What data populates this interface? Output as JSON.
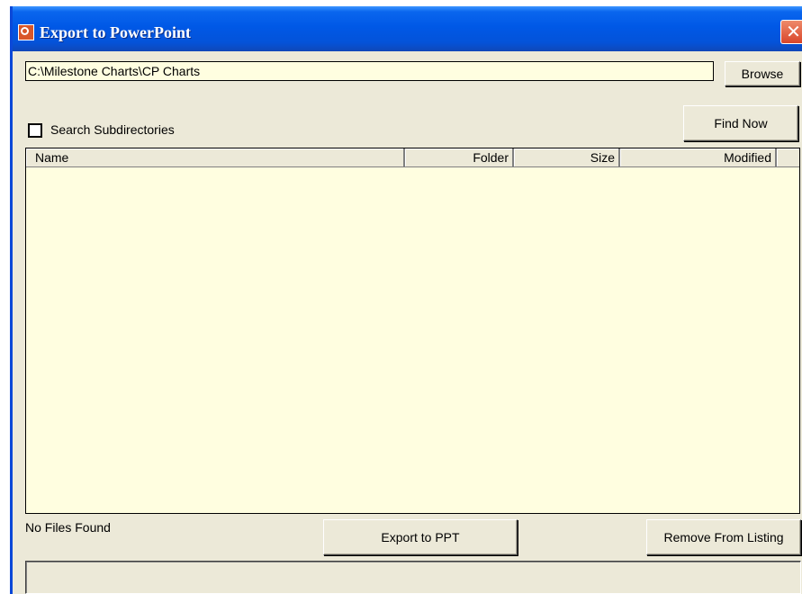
{
  "window": {
    "title": "Export to PowerPoint",
    "close_glyph": "✕"
  },
  "path": {
    "value": "C:\\Milestone Charts\\CP Charts"
  },
  "buttons": {
    "browse": "Browse",
    "find_now": "Find Now",
    "export": "Export to PPT",
    "remove": "Remove From Listing"
  },
  "options": {
    "search_subdirectories_label": "Search Subdirectories",
    "search_subdirectories_checked": false
  },
  "list": {
    "columns": [
      "Name",
      "Folder",
      "Size",
      "Modified",
      ""
    ],
    "rows": []
  },
  "status": {
    "message": "No Files Found",
    "bar_text": ""
  },
  "colors": {
    "list_background": "#fffee0",
    "window_background": "#ece9d8",
    "titlebar": "#0058e6"
  },
  "icons": {
    "app": "powerpoint-icon",
    "close": "close-icon"
  }
}
